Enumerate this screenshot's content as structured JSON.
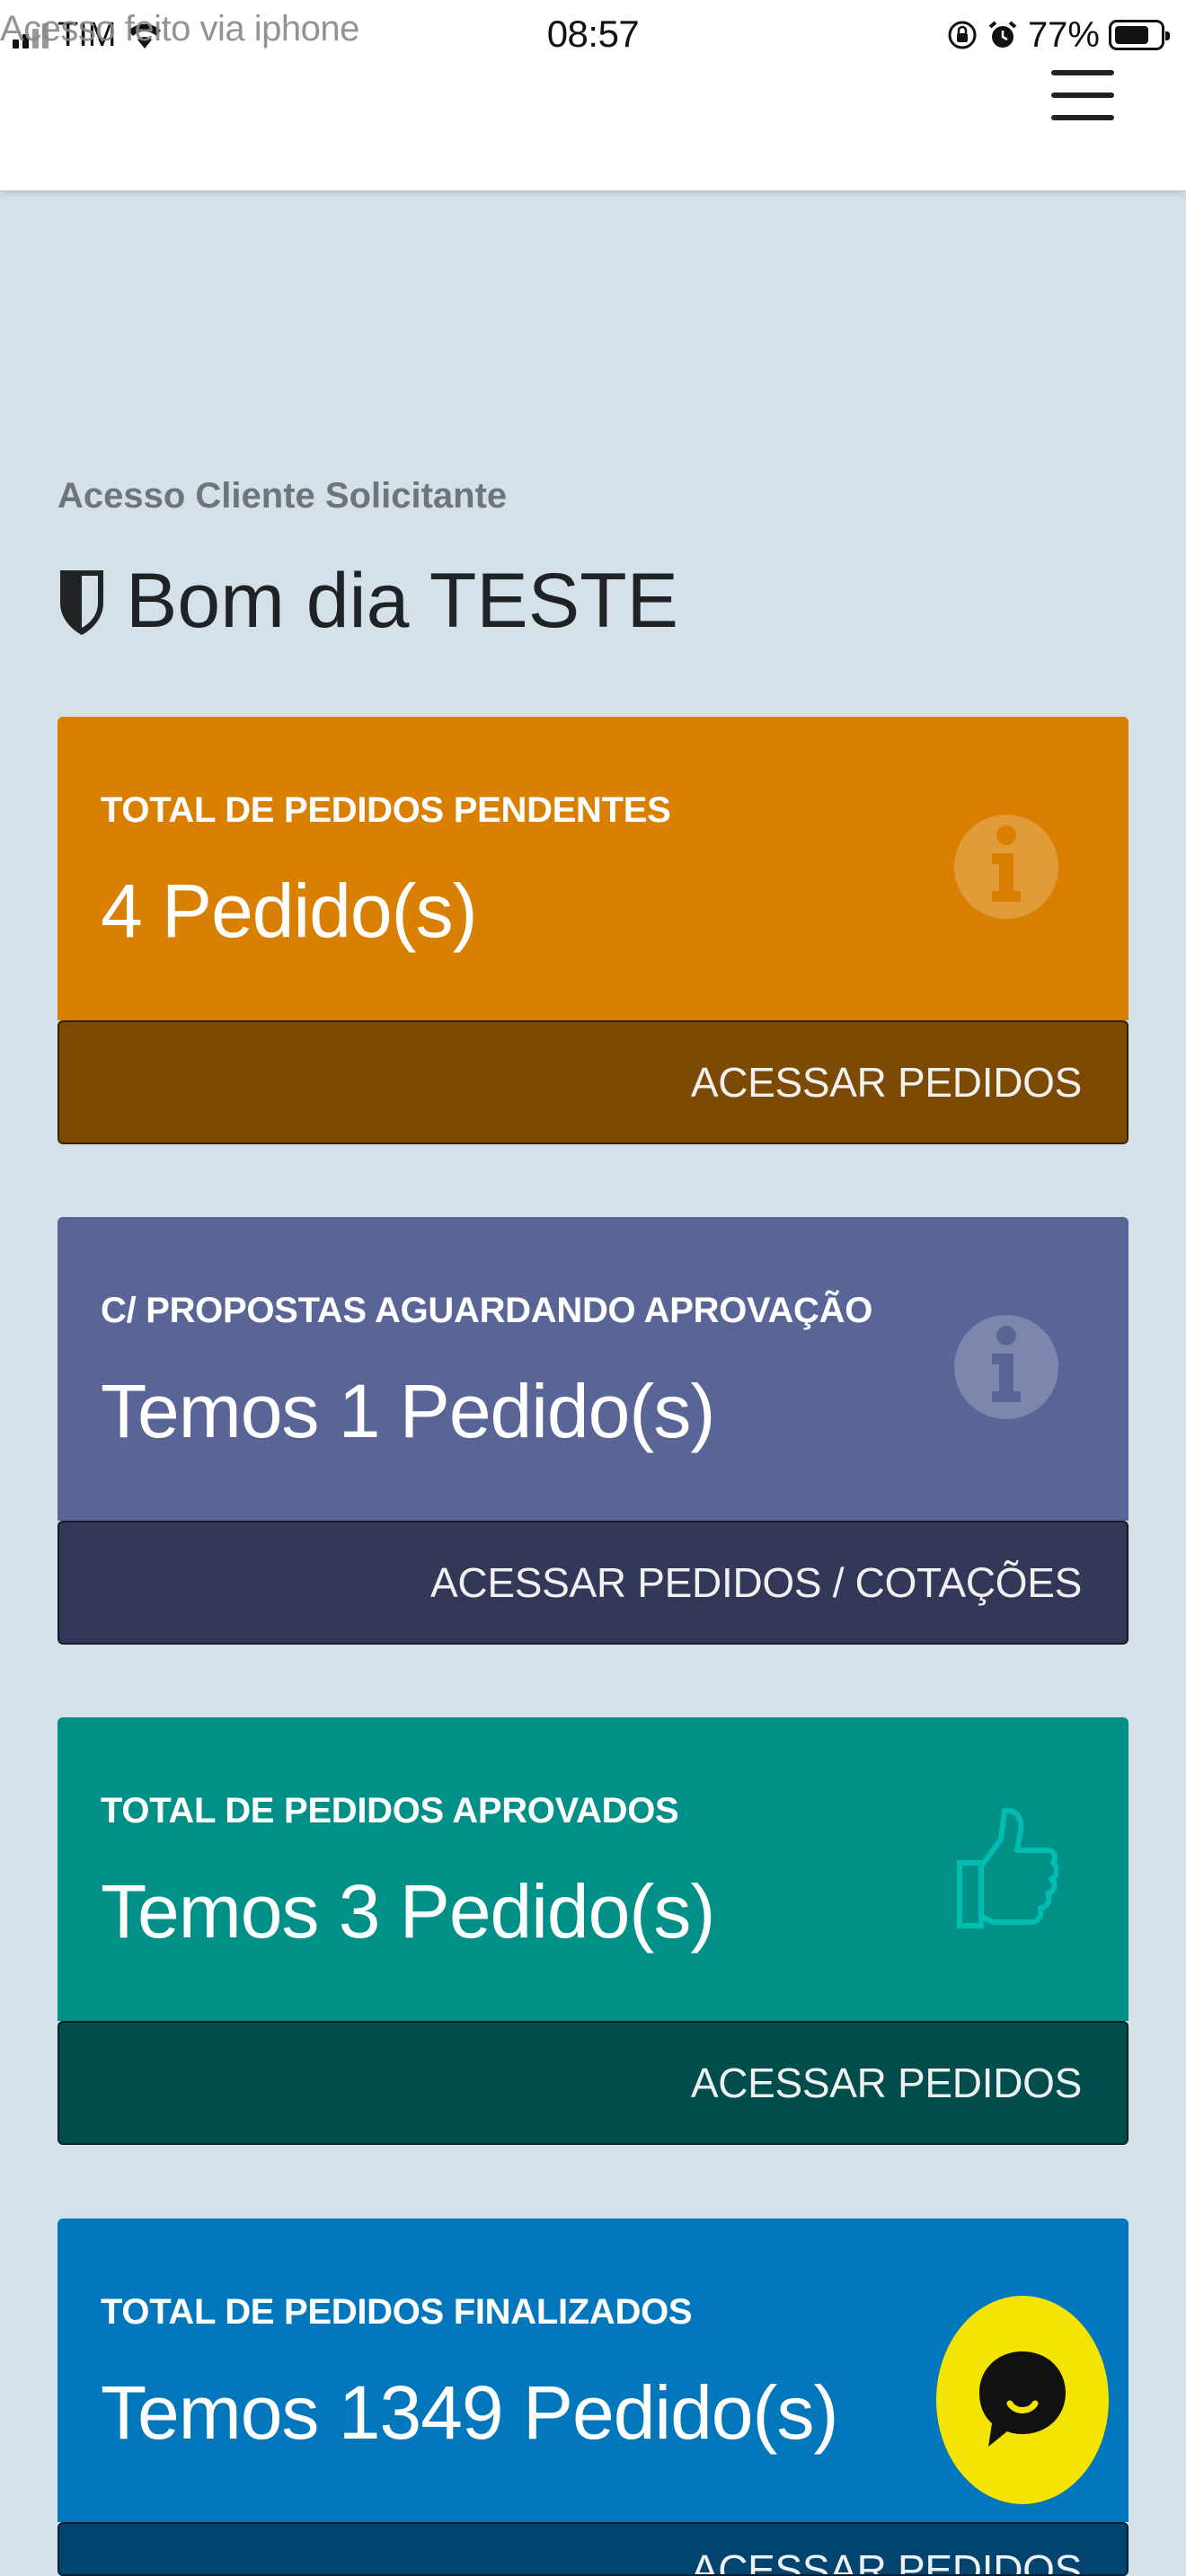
{
  "status_bar": {
    "carrier": "TIM",
    "watermark": "Acesso feito via iphone",
    "time": "08:57",
    "battery": "77%",
    "battery_level": 0.77
  },
  "header": {
    "menu_icon": "hamburger-menu-icon"
  },
  "greeting": {
    "subtitle": "Acesso Cliente Solicitante",
    "title": "Bom dia TESTE",
    "icon": "shield-icon"
  },
  "cards": [
    {
      "label": "TOTAL DE PEDIDOS PENDENTES",
      "value": "4 Pedido(s)",
      "action": "ACESSAR PEDIDOS",
      "icon": "info-circle-icon",
      "color": "#d97f02",
      "footer_color": "#7c4a02"
    },
    {
      "label": "C/ PROPOSTAS AGUARDANDO APROVAÇÃO",
      "value": "Temos 1 Pedido(s)",
      "action": "ACESSAR PEDIDOS / COTAÇÕES",
      "icon": "info-circle-icon",
      "color": "#596597",
      "footer_color": "#333858"
    },
    {
      "label": "TOTAL DE PEDIDOS APROVADOS",
      "value": "Temos 3 Pedido(s)",
      "action": "ACESSAR PEDIDOS",
      "icon": "thumbs-up-icon",
      "color": "#009088",
      "footer_color": "#004d4b"
    },
    {
      "label": "TOTAL DE PEDIDOS FINALIZADOS",
      "value": "Temos 1349 Pedido(s)",
      "action": "ACESSAR PEDIDOS",
      "icon": "",
      "color": "#0277bb",
      "footer_color": "#014470"
    }
  ],
  "chat": {
    "icon": "chat-bubble-icon",
    "color": "#f5e400"
  }
}
